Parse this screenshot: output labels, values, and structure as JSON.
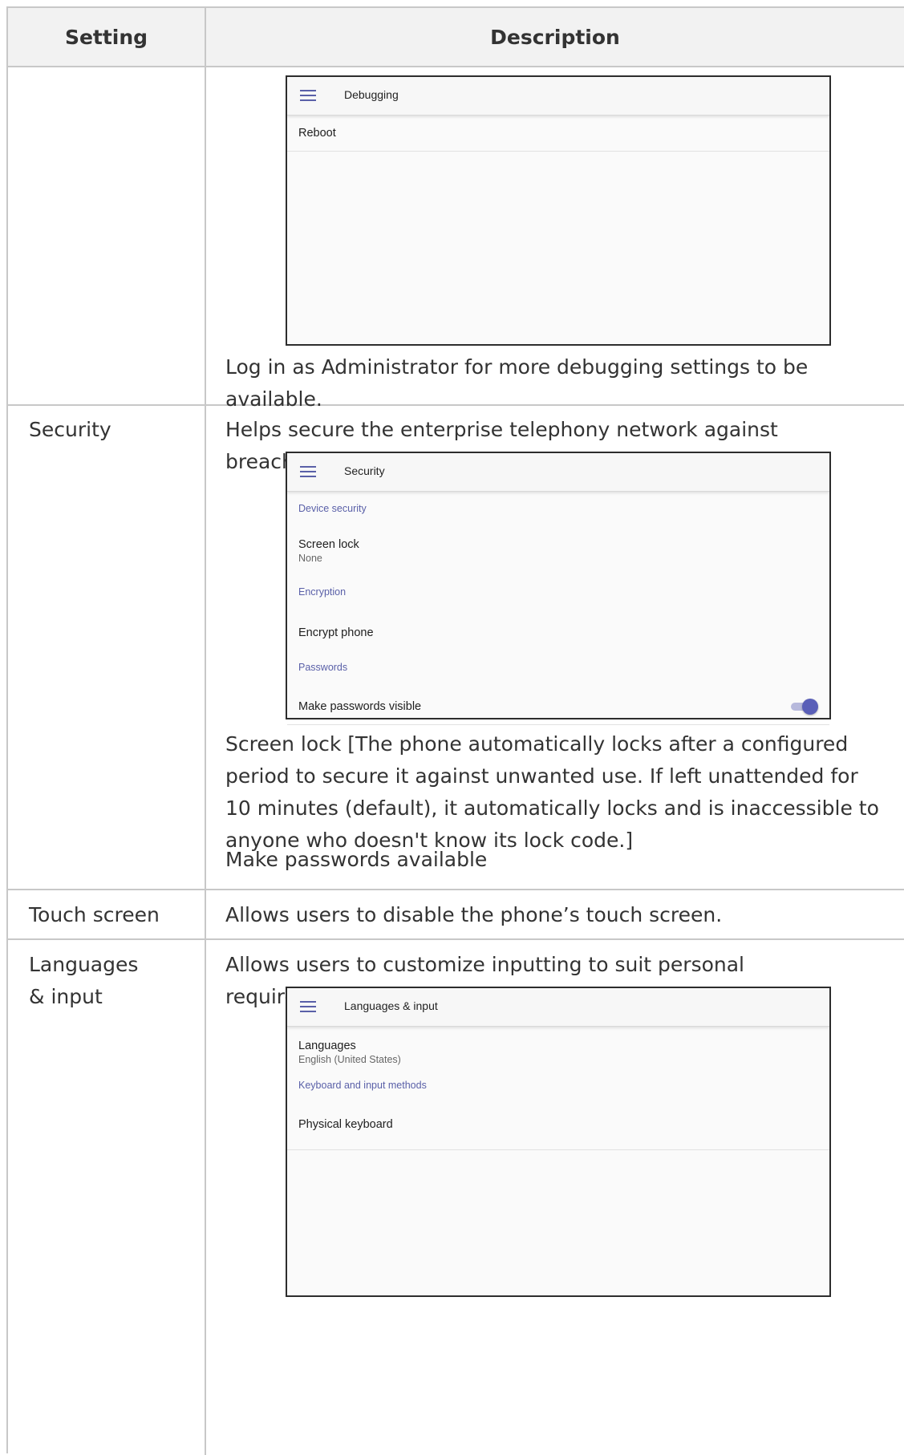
{
  "table": {
    "header": {
      "setting": "Setting",
      "description": "Description"
    },
    "rows": [
      {
        "setting": "",
        "screen": {
          "title": "Debugging",
          "items": [
            {
              "title": "Reboot"
            }
          ]
        },
        "note": "Log in as Administrator for more debugging settings to be available."
      },
      {
        "setting": "Security",
        "intro": "Helps secure the enterprise telephony network against breaches.",
        "screen": {
          "title": "Security",
          "sections": [
            {
              "header": "Device security",
              "items": [
                {
                  "title": "Screen lock",
                  "subtitle": "None"
                }
              ]
            },
            {
              "header": "Encryption",
              "items": [
                {
                  "title": "Encrypt phone"
                }
              ]
            },
            {
              "header": "Passwords",
              "items": [
                {
                  "title": "Make passwords visible",
                  "toggle": true
                }
              ]
            }
          ]
        },
        "notes": [
          "Screen lock [The phone automatically locks after a configured period to secure it against unwanted use. If left unattended for 10 minutes (default), it automatically locks and is inaccessible to anyone who doesn't know its lock code.]",
          "Make passwords available"
        ]
      },
      {
        "setting": "Touch screen",
        "description": "Allows users to disable the phone’s touch screen."
      },
      {
        "setting_line1": "Languages",
        "setting_line2": "& input",
        "intro": "Allows users to customize inputting to suit personal requirements.",
        "screen": {
          "title": "Languages & input",
          "items": [
            {
              "title": "Languages",
              "subtitle": "English (United States)"
            },
            {
              "section": "Keyboard and input methods"
            },
            {
              "title": "Physical keyboard"
            }
          ]
        }
      }
    ]
  },
  "colors": {
    "accent": "#5a60a8",
    "border": "#c8c8c8",
    "header_bg": "#f2f2f2"
  }
}
